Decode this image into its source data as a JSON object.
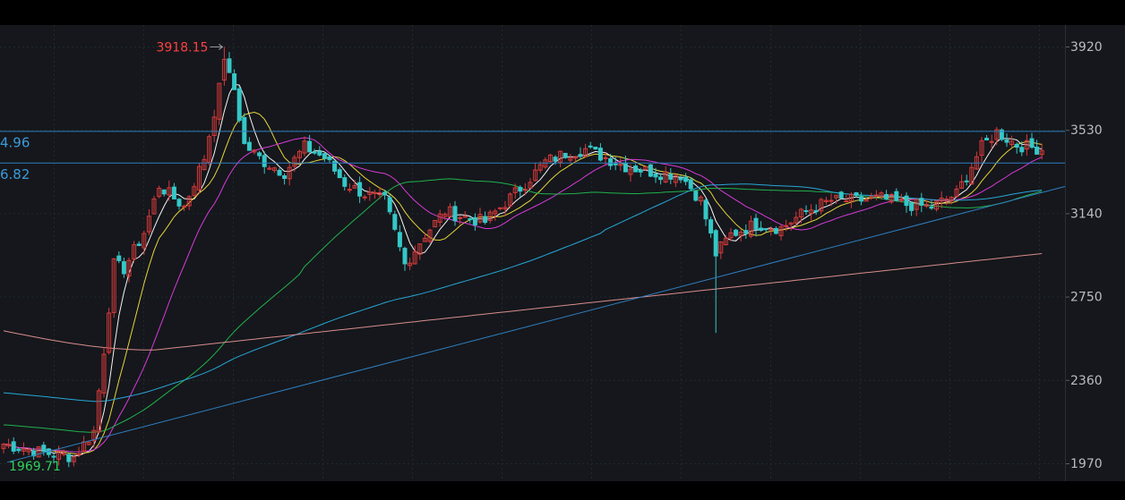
{
  "colors": {
    "background": "#15171c",
    "frame": "#000000",
    "grid": "#1f2b2b",
    "axis_text": "#b9bcc3",
    "up": "#d63a3a",
    "down": "#35c7c7",
    "ma5": "#f4f4f4",
    "ma10": "#e7d53a",
    "ma20": "#d83ad8",
    "ma60": "#22b14c",
    "ma120": "#28a6d6",
    "ma250": "#d98d8d",
    "trendline": "#2f7fc0",
    "high_label": "#ff4040",
    "low_label": "#2fd05a",
    "level_line": "#2f7fc0",
    "level_text": "#3b9ad9"
  },
  "chart_data": {
    "type": "candlestick",
    "ylim": [
      1940,
      3990
    ],
    "yticks": [
      1970,
      2360,
      2750,
      3140,
      3530,
      3920
    ],
    "grid": true,
    "high_marker": {
      "label": "3918.15",
      "value": 3918.15
    },
    "low_marker": {
      "label": "1969.71",
      "value": 1969.71
    },
    "levels": [
      {
        "label": "4.96",
        "value": 3524.96
      },
      {
        "label": "6.82",
        "value": 3376.82
      }
    ],
    "series": [
      {
        "name": "",
        "role": "ma5"
      },
      {
        "name": "",
        "role": "ma10"
      },
      {
        "name": "",
        "role": "ma20"
      },
      {
        "name": "",
        "role": "ma60"
      },
      {
        "name": "",
        "role": "ma120"
      },
      {
        "name": "",
        "role": "ma250"
      }
    ],
    "trend_line": {
      "from_value": 1969.71,
      "to_value": 3265
    }
  }
}
